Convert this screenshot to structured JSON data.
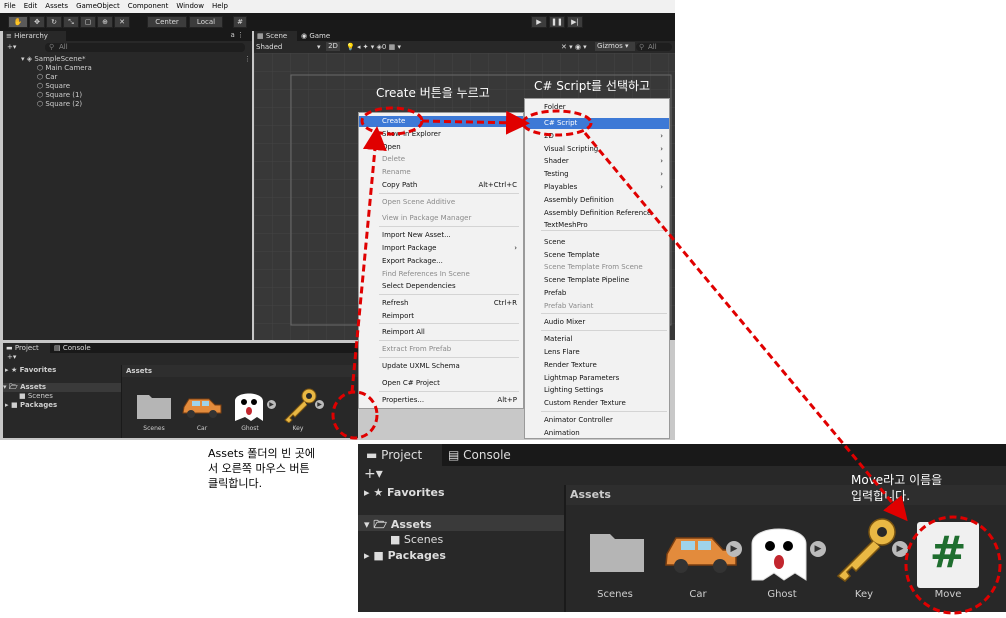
{
  "menubar": [
    "File",
    "Edit",
    "Assets",
    "GameObject",
    "Component",
    "Window",
    "Help"
  ],
  "toolbar": {
    "pivot": "Center",
    "space": "Local"
  },
  "hierarchy": {
    "tab": "Hierarchy",
    "search": "All",
    "scene": "SampleScene*",
    "objects": [
      "Main Camera",
      "Car",
      "Square",
      "Square (1)",
      "Square (2)"
    ]
  },
  "scene": {
    "tabs": [
      "Scene",
      "Game"
    ],
    "shading": "Shaded",
    "mode2d": "2D",
    "fx_count": "0",
    "gizmos": "Gizmos",
    "search": "All"
  },
  "project_small": {
    "tabs": [
      "Project",
      "Console"
    ],
    "favorites": "Favorites",
    "assets": "Assets",
    "scenes": "Scenes",
    "packages": "Packages",
    "header": "Assets",
    "items": [
      "Scenes",
      "Car",
      "Ghost",
      "Key"
    ]
  },
  "context_menu": [
    {
      "label": "Create",
      "shortcut": "",
      "disabled": false,
      "selected": true
    },
    {
      "label": "Show in Explorer",
      "shortcut": "",
      "disabled": false
    },
    {
      "label": "Open",
      "shortcut": "",
      "disabled": false
    },
    {
      "label": "Delete",
      "shortcut": "",
      "disabled": true
    },
    {
      "label": "Rename",
      "shortcut": "",
      "disabled": true
    },
    {
      "label": "Copy Path",
      "shortcut": "Alt+Ctrl+C",
      "disabled": false
    },
    {
      "label": "Open Scene Additive",
      "shortcut": "",
      "disabled": true
    },
    {
      "label": "View in Package Manager",
      "shortcut": "",
      "disabled": true
    },
    {
      "label": "Import New Asset...",
      "shortcut": "",
      "disabled": false
    },
    {
      "label": "Import Package",
      "shortcut": "",
      "disabled": false
    },
    {
      "label": "Export Package...",
      "shortcut": "",
      "disabled": false
    },
    {
      "label": "Find References In Scene",
      "shortcut": "",
      "disabled": true
    },
    {
      "label": "Select Dependencies",
      "shortcut": "",
      "disabled": false
    },
    {
      "label": "Refresh",
      "shortcut": "Ctrl+R",
      "disabled": false
    },
    {
      "label": "Reimport",
      "shortcut": "",
      "disabled": false
    },
    {
      "label": "Reimport All",
      "shortcut": "",
      "disabled": false
    },
    {
      "label": "Extract From Prefab",
      "shortcut": "",
      "disabled": true
    },
    {
      "label": "Update UXML Schema",
      "shortcut": "",
      "disabled": false
    },
    {
      "label": "Open C# Project",
      "shortcut": "",
      "disabled": false
    },
    {
      "label": "Properties...",
      "shortcut": "Alt+P",
      "disabled": false
    }
  ],
  "create_submenu": [
    {
      "label": "Folder",
      "disabled": false
    },
    {
      "label": "C# Script",
      "disabled": false,
      "selected": true
    },
    {
      "label": "2D",
      "disabled": false,
      "arrow": true
    },
    {
      "label": "Visual Scripting",
      "disabled": false,
      "arrow": true
    },
    {
      "label": "Shader",
      "disabled": false,
      "arrow": true
    },
    {
      "label": "Testing",
      "disabled": false,
      "arrow": true
    },
    {
      "label": "Playables",
      "disabled": false,
      "arrow": true
    },
    {
      "label": "Assembly Definition",
      "disabled": false
    },
    {
      "label": "Assembly Definition Reference",
      "disabled": false
    },
    {
      "label": "TextMeshPro",
      "disabled": false
    },
    {
      "label": "Scene",
      "disabled": false
    },
    {
      "label": "Scene Template",
      "disabled": false
    },
    {
      "label": "Scene Template From Scene",
      "disabled": true
    },
    {
      "label": "Scene Template Pipeline",
      "disabled": false
    },
    {
      "label": "Prefab",
      "disabled": false
    },
    {
      "label": "Prefab Variant",
      "disabled": true
    },
    {
      "label": "Audio Mixer",
      "disabled": false
    },
    {
      "label": "Material",
      "disabled": false
    },
    {
      "label": "Lens Flare",
      "disabled": false
    },
    {
      "label": "Render Texture",
      "disabled": false
    },
    {
      "label": "Lightmap Parameters",
      "disabled": false
    },
    {
      "label": "Lighting Settings",
      "disabled": false
    },
    {
      "label": "Custom Render Texture",
      "disabled": false
    },
    {
      "label": "Animator Controller",
      "disabled": false
    },
    {
      "label": "Animation",
      "disabled": false
    }
  ],
  "annotations": {
    "create_note": "Create 버튼을 누르고",
    "script_note": "C# Script를 선택하고",
    "rightclick_note": "Assets 폴더의 빈 곳에\n서 오른쪽 마우스 버튼\n클릭합니다.",
    "rename_note_1": "Move라고 이름을",
    "rename_note_2": "입력합니다."
  },
  "project_zoom": {
    "tabs": [
      "Project",
      "Console"
    ],
    "favorites": "Favorites",
    "assets": "Assets",
    "scenes": "Scenes",
    "packages": "Packages",
    "header": "Assets",
    "items": [
      "Scenes",
      "Car",
      "Ghost",
      "Key",
      "Move"
    ],
    "script_symbol": "#"
  },
  "colors": {
    "annotation_red": "#e00000",
    "menu_highlight": "#3d79d6",
    "panel_bg": "#282828",
    "tab_bg": "#191919"
  }
}
